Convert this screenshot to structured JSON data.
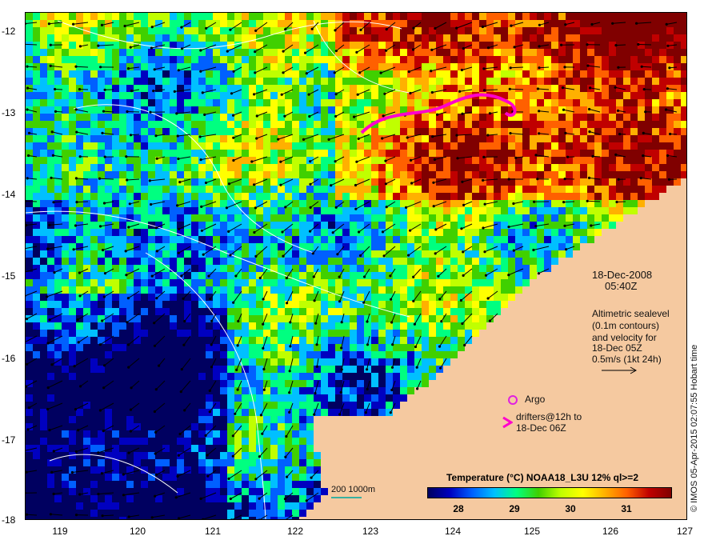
{
  "map": {
    "date_line1": "18-Dec-2008",
    "date_line2": "05:40Z",
    "legend_lines": [
      "Altimetric sealevel",
      "(0.1m contours)",
      "and velocity for",
      "18-Dec 05Z",
      "0.5m/s (1kt 24h)"
    ],
    "argo_label": "Argo",
    "drifters_line1": "drifters@12h to",
    "drifters_line2": "18-Dec 06Z",
    "scale_label": "200  1000m",
    "credit": "© IMOS 05-Apr-2015 02:07:55 Hobart time",
    "colorbar_title": "Temperature (°C) NOAA18_L3U 12% ql>=2",
    "colorbar_ticks": [
      "28",
      "29",
      "30",
      "31"
    ],
    "y_ticks": [
      "-12",
      "-13",
      "-14",
      "-15",
      "-16",
      "-17",
      "-18"
    ],
    "x_ticks": [
      "119",
      "120",
      "121",
      "122",
      "123",
      "124",
      "125",
      "126",
      "127"
    ],
    "colors": {
      "land": "#f5c9a0",
      "argo_marker": "#e020e0",
      "drifter_track": "#ff00cc",
      "contour": "#ffffff",
      "colorbar": [
        "#000060",
        "#0000c0",
        "#0060ff",
        "#00c0ff",
        "#00ff80",
        "#40d000",
        "#c0ff00",
        "#ffff00",
        "#ffb000",
        "#ff6000",
        "#c00000",
        "#800000"
      ]
    }
  }
}
